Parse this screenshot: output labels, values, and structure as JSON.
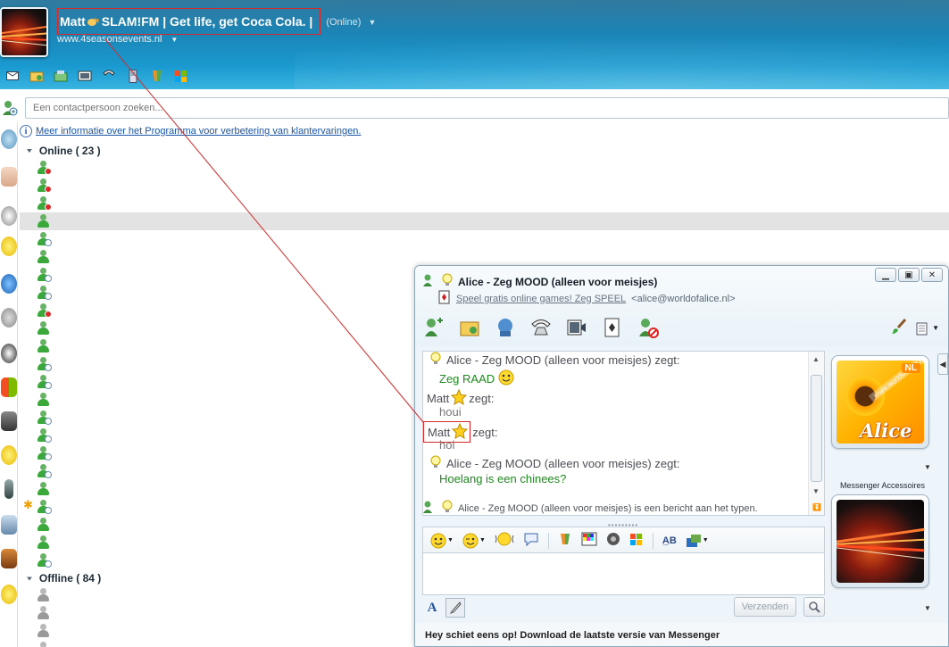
{
  "header": {
    "display_name": "Matt",
    "personal_message": "SLAM!FM | Get life, get Coca Cola. |",
    "status": "(Online)",
    "website": "www.4seasonsevents.nl"
  },
  "search": {
    "placeholder": "Een contactpersoon zoeken..."
  },
  "info_link": "Meer informatie over het Programma voor verbetering van klantervaringen.",
  "groups": {
    "online": "Online ( 23 )",
    "offline": "Offline ( 84 )"
  },
  "online_contacts": [
    {
      "status": "busy"
    },
    {
      "status": "busy"
    },
    {
      "status": "busy"
    },
    {
      "status": "online",
      "selected": true
    },
    {
      "status": "away"
    },
    {
      "status": "online"
    },
    {
      "status": "away"
    },
    {
      "status": "away"
    },
    {
      "status": "busy"
    },
    {
      "status": "online"
    },
    {
      "status": "online"
    },
    {
      "status": "away"
    },
    {
      "status": "away"
    },
    {
      "status": "online"
    },
    {
      "status": "away"
    },
    {
      "status": "away"
    },
    {
      "status": "away"
    },
    {
      "status": "away"
    },
    {
      "status": "online"
    },
    {
      "status": "away",
      "starred": true
    },
    {
      "status": "online"
    },
    {
      "status": "online"
    },
    {
      "status": "away"
    }
  ],
  "offline_contacts": [
    {
      "status": "offline"
    },
    {
      "status": "offline"
    },
    {
      "status": "offline"
    },
    {
      "status": "offline"
    }
  ],
  "chat": {
    "title": "Alice - Zeg MOOD (alleen voor meisjes)",
    "subtitle_link": "Speel gratis online games! Zeg SPEEL",
    "email": "<alice@worldofalice.nl>",
    "messages": [
      {
        "sender": "Alice - Zeg MOOD (alleen voor meisjes) zegt:",
        "text": "Zeg RAAD"
      },
      {
        "sender": "Matt",
        "verb": "zegt:",
        "text": "houi"
      },
      {
        "sender": "Matt",
        "verb": "zegt:",
        "text": "hoi"
      },
      {
        "sender": "Alice - Zeg MOOD (alleen voor meisjes) zegt:",
        "text": "Hoelang is een chinees?"
      }
    ],
    "typing_status": "Alice - Zeg MOOD (alleen voor meisjes) is een bericht aan het typen.",
    "send_label": "Verzenden",
    "accessories_label": "Messenger Accessoires",
    "contact_pic_brand": "Alice",
    "contact_pic_badge": "NL",
    "contact_pic_url": "www.worldofalice.nl",
    "ad_text": "Hey schiet eens op! Download de laatste versie van Messenger"
  },
  "colors": {
    "header_blue": "#1a9ad0",
    "link_blue": "#1a55a8",
    "incoming_message": "#1d8a1d",
    "own_message": "#777777",
    "highlight_red": "#d62a2a",
    "status_online": "#3aa83a",
    "status_busy": "#d92b2b",
    "status_away": "#6a8fb5",
    "status_offline": "#9a9a9a"
  }
}
